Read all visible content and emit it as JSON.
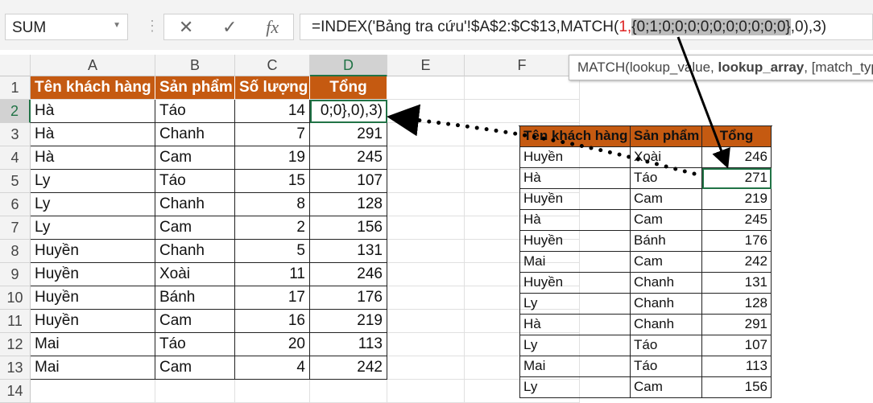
{
  "name_box": "SUM",
  "formula_bar": {
    "cancel": "✕",
    "enter": "✓",
    "fx": "fx",
    "part1": "=INDEX('Bảng tra cứu'!$A$2:$C$13,MATCH(",
    "p_open": "1,",
    "array": "{0;1;0;0;0;0;0;0;0;0;0;0}",
    "p_close": ",0)",
    "part2": ",3)"
  },
  "tooltip": {
    "fn": "MATCH(lookup_value, ",
    "bold": "lookup_array",
    "rest": ", [match_type])"
  },
  "columns": [
    "A",
    "B",
    "C",
    "D",
    "E",
    "F"
  ],
  "rows": [
    "1",
    "2",
    "3",
    "4",
    "5",
    "6",
    "7",
    "8",
    "9",
    "10",
    "11",
    "12",
    "13",
    "14"
  ],
  "left_table": {
    "headers": [
      "Tên khách hàng",
      "Sản phẩm",
      "Số lượng",
      "Tổng"
    ],
    "data": [
      [
        "Hà",
        "Táo",
        "14",
        "0;0},0),3)"
      ],
      [
        "Hà",
        "Chanh",
        "7",
        "291"
      ],
      [
        "Hà",
        "Cam",
        "19",
        "245"
      ],
      [
        "Ly",
        "Táo",
        "15",
        "107"
      ],
      [
        "Ly",
        "Chanh",
        "8",
        "128"
      ],
      [
        "Ly",
        "Cam",
        "2",
        "156"
      ],
      [
        "Huyền",
        "Chanh",
        "5",
        "131"
      ],
      [
        "Huyền",
        "Xoài",
        "11",
        "246"
      ],
      [
        "Huyền",
        "Bánh",
        "17",
        "176"
      ],
      [
        "Huyền",
        "Cam",
        "16",
        "219"
      ],
      [
        "Mai",
        "Táo",
        "20",
        "113"
      ],
      [
        "Mai",
        "Cam",
        "4",
        "242"
      ]
    ]
  },
  "right_table": {
    "headers": [
      "Tên khách hàng",
      "Sản phẩm",
      "Tổng"
    ],
    "data": [
      [
        "Huyền",
        "Xoài",
        "246"
      ],
      [
        "Hà",
        "Táo",
        "271"
      ],
      [
        "Huyền",
        "Cam",
        "219"
      ],
      [
        "Hà",
        "Cam",
        "245"
      ],
      [
        "Huyền",
        "Bánh",
        "176"
      ],
      [
        "Mai",
        "Cam",
        "242"
      ],
      [
        "Huyền",
        "Chanh",
        "131"
      ],
      [
        "Ly",
        "Chanh",
        "128"
      ],
      [
        "Hà",
        "Chanh",
        "291"
      ],
      [
        "Ly",
        "Táo",
        "107"
      ],
      [
        "Mai",
        "Táo",
        "113"
      ],
      [
        "Ly",
        "Cam",
        "156"
      ]
    ]
  },
  "colors": {
    "header": "#c55a11",
    "select": "#217346"
  }
}
